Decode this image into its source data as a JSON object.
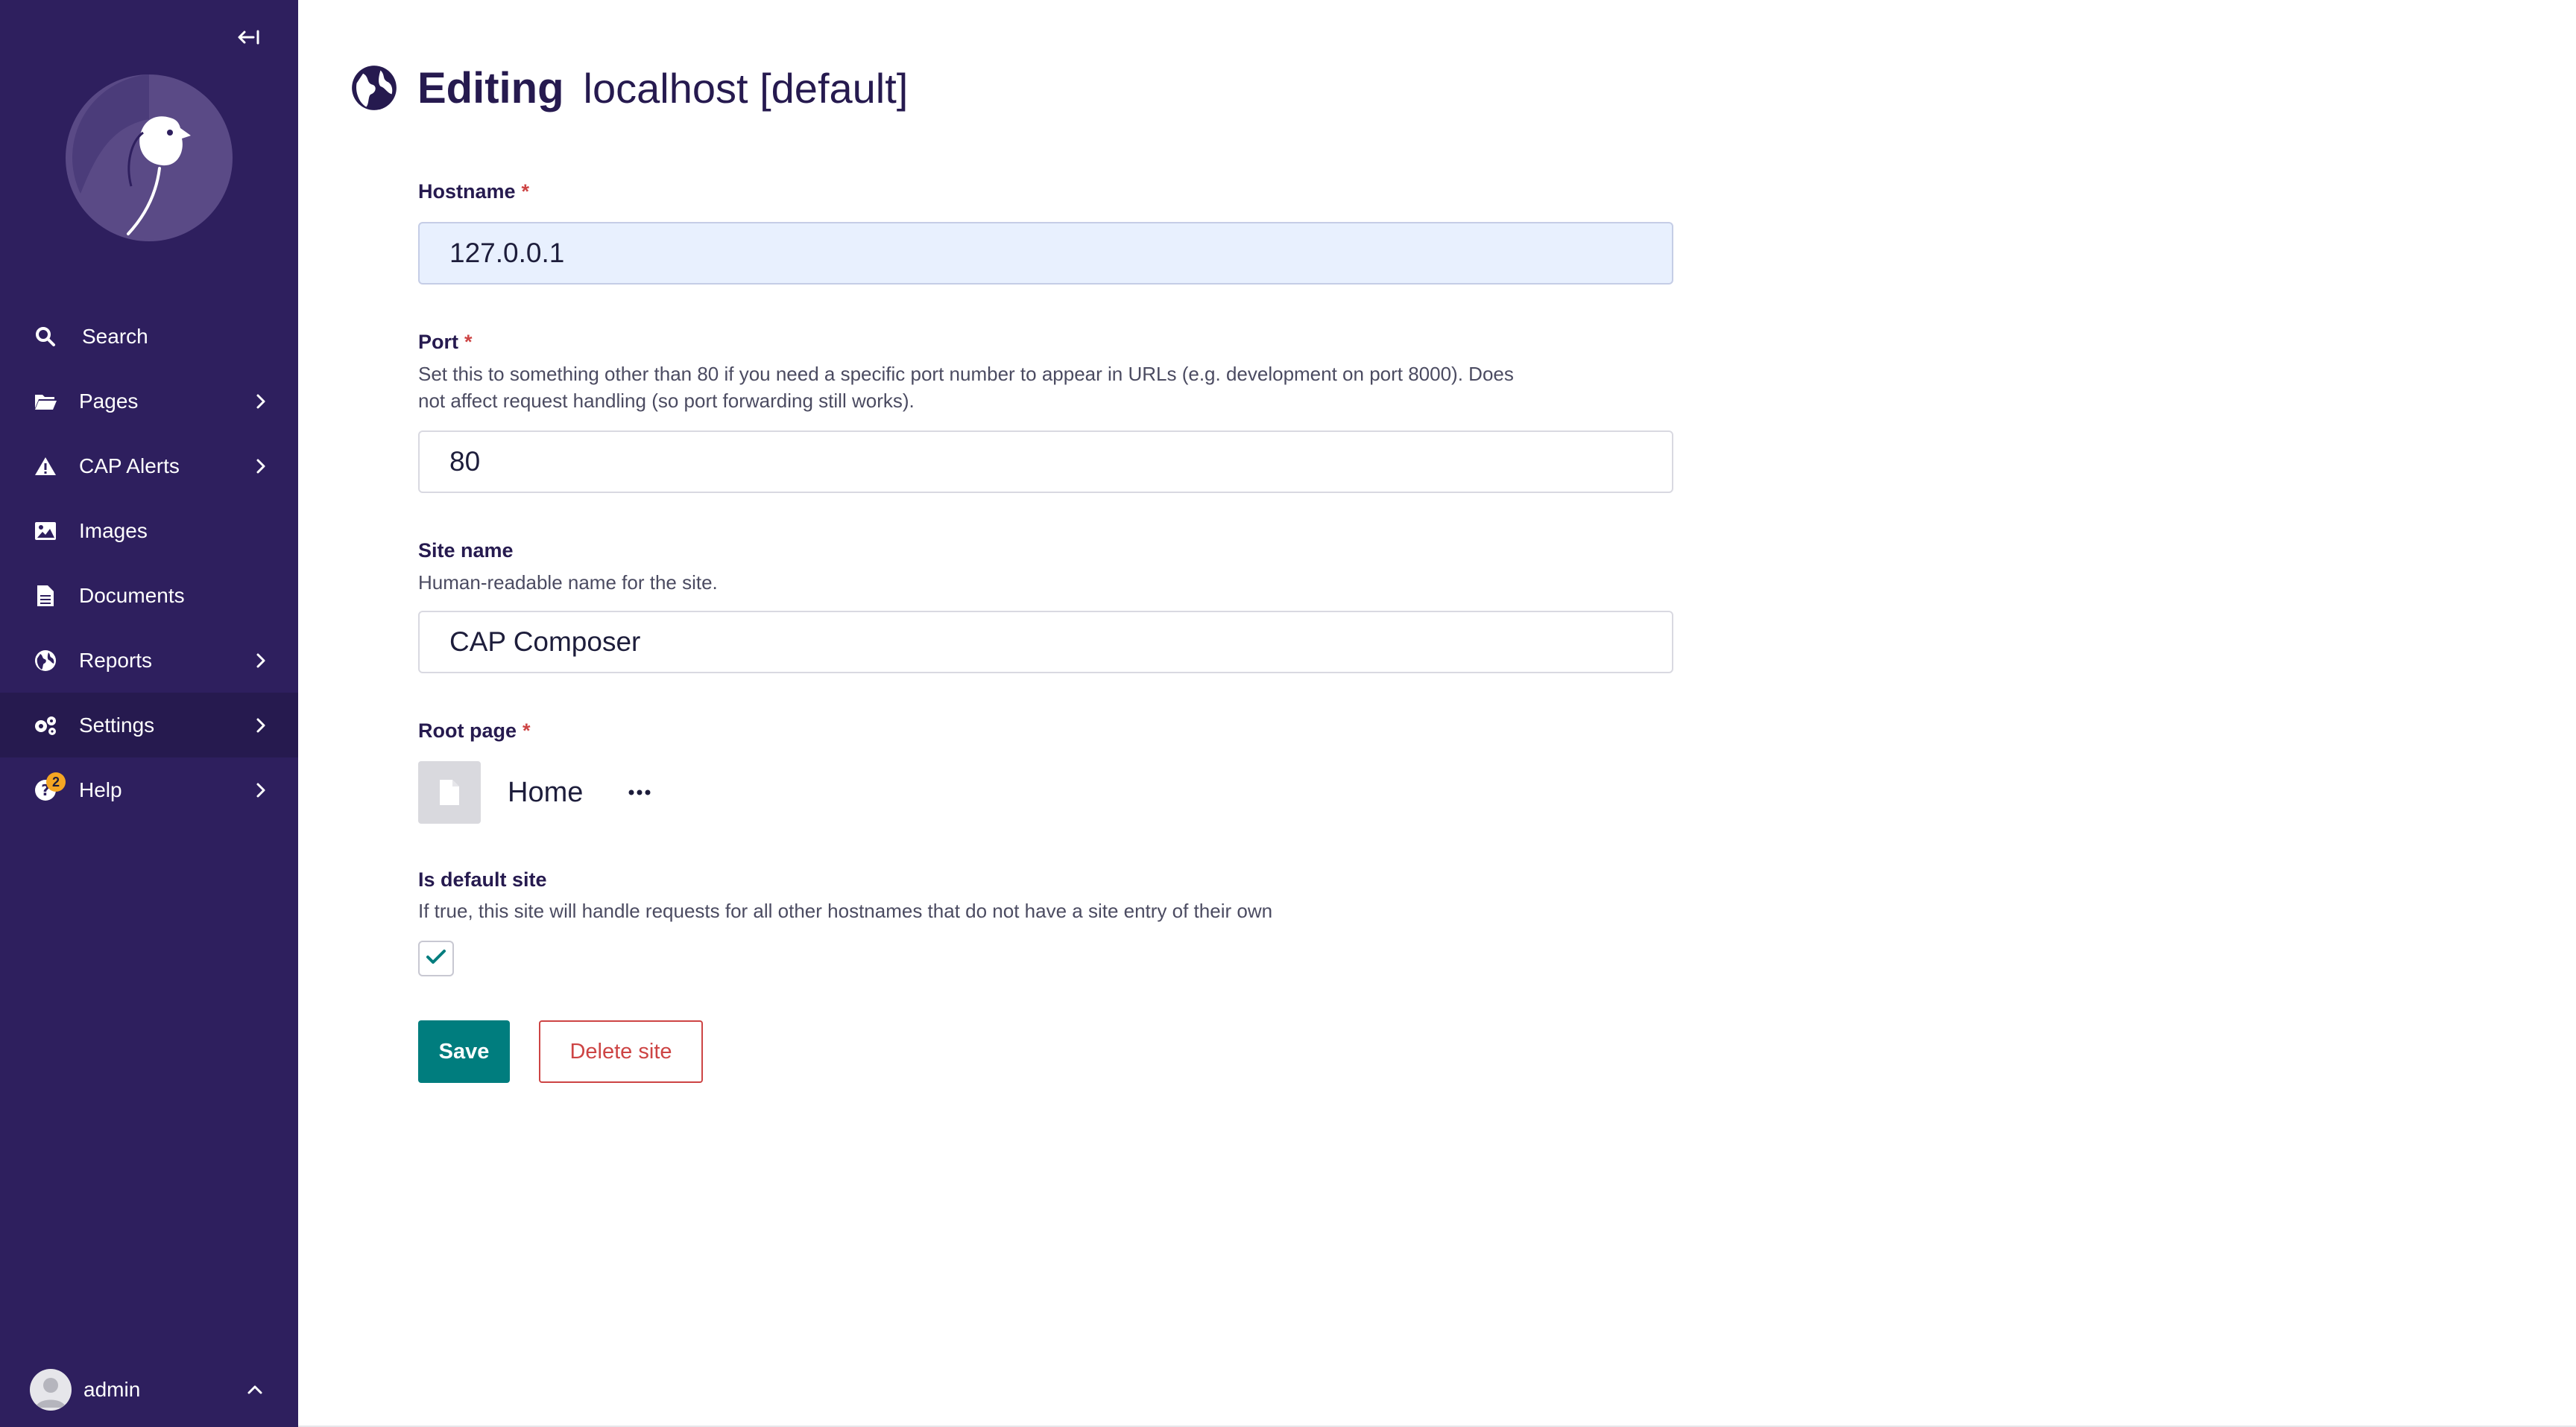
{
  "sidebar": {
    "collapse_icon": "collapse-sidebar-icon",
    "items": [
      {
        "label": "Search",
        "icon": "search-icon",
        "has_chevron": false
      },
      {
        "label": "Pages",
        "icon": "folder-icon",
        "has_chevron": true
      },
      {
        "label": "CAP Alerts",
        "icon": "warning-icon",
        "has_chevron": true
      },
      {
        "label": "Images",
        "icon": "image-icon",
        "has_chevron": false
      },
      {
        "label": "Documents",
        "icon": "document-icon",
        "has_chevron": false
      },
      {
        "label": "Reports",
        "icon": "globe-icon",
        "has_chevron": true
      },
      {
        "label": "Settings",
        "icon": "cogs-icon",
        "has_chevron": true,
        "active": true
      },
      {
        "label": "Help",
        "icon": "help-icon",
        "has_chevron": true,
        "badge": "2"
      }
    ],
    "account": {
      "label": "admin"
    }
  },
  "header": {
    "title": "Editing",
    "subtitle": "localhost [default]"
  },
  "form": {
    "hostname": {
      "label": "Hostname",
      "required": "*",
      "value": "127.0.0.1"
    },
    "port": {
      "label": "Port",
      "required": "*",
      "help_line1": "Set this to something other than 80 if you need a specific port number to appear in URLs (e.g. development on port 8000). Does",
      "help_line2": "not affect request handling (so port forwarding still works).",
      "value": "80"
    },
    "site_name": {
      "label": "Site name",
      "help": "Human-readable name for the site.",
      "value": "CAP Composer"
    },
    "root_page": {
      "label": "Root page",
      "required": "*",
      "page_title": "Home"
    },
    "is_default": {
      "label": "Is default site",
      "help": "If true, this site will handle requests for all other hostnames that do not have a site entry of their own",
      "checked": true
    }
  },
  "actions": {
    "save_label": "Save",
    "delete_label": "Delete site"
  },
  "colors": {
    "sidebar": "#2e1f5e",
    "primary": "#007d7e",
    "danger": "#cd4444",
    "heading": "#261a4f"
  }
}
